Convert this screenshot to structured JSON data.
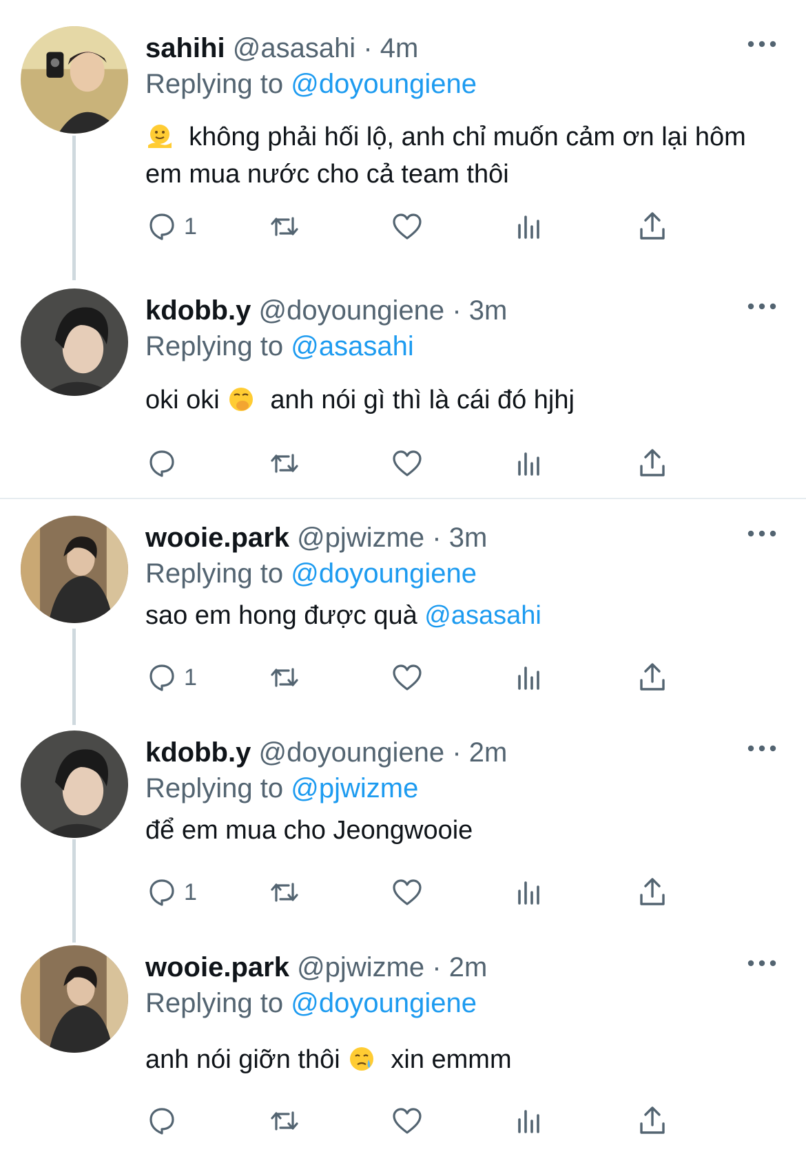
{
  "colors": {
    "accent": "#1d9bf0",
    "muted": "#536471",
    "text": "#0f1419",
    "thread_line": "#cfd9de"
  },
  "tweets": [
    {
      "name": "sahihi",
      "handle": "@asasahi",
      "time": "4m",
      "replying_prefix": "Replying to",
      "replying_to": "@doyoungiene",
      "text_before_emoji": "",
      "emoji": "melting-face-emoji",
      "text_after_emoji": "không phải hối lộ, anh chỉ muốn cảm ơn lại hôm em mua nước cho cả team thôi",
      "reply_count": "1"
    },
    {
      "name": "kdobb.y",
      "handle": "@doyoungiene",
      "time": "3m",
      "replying_prefix": "Replying to",
      "replying_to": "@asasahi",
      "text_before_emoji": "oki oki",
      "emoji": "hand-over-mouth-emoji",
      "text_after_emoji": "anh nói gì thì là cái đó hjhj",
      "reply_count": ""
    },
    {
      "name": "wooie.park",
      "handle": "@pjwizme",
      "time": "3m",
      "replying_prefix": "Replying to",
      "replying_to": "@doyoungiene",
      "text_before_emoji": "sao em hong được quà",
      "mention_in_text": "@asasahi",
      "reply_count": "1"
    },
    {
      "name": "kdobb.y",
      "handle": "@doyoungiene",
      "time": "2m",
      "replying_prefix": "Replying to",
      "replying_to": "@pjwizme",
      "text_before_emoji": "để em mua cho Jeongwooie",
      "reply_count": "1"
    },
    {
      "name": "wooie.park",
      "handle": "@pjwizme",
      "time": "2m",
      "replying_prefix": "Replying to",
      "replying_to": "@doyoungiene",
      "text_before_emoji": "anh nói giỡn thôi",
      "emoji": "crying-face-emoji",
      "text_after_emoji": "xin emmm",
      "reply_count": ""
    }
  ],
  "separator_dot": "·",
  "icons": [
    "reply-icon",
    "retweet-icon",
    "like-icon",
    "views-icon",
    "share-icon",
    "more-icon"
  ]
}
